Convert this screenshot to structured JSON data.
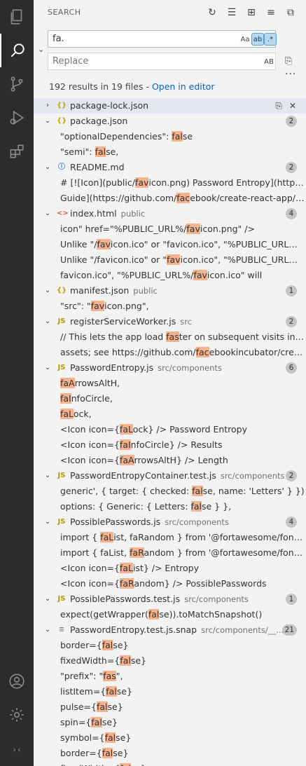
{
  "panel": {
    "title": "SEARCH",
    "search_value": "fa.",
    "match_case_label": "Aa",
    "whole_word_label": "ab",
    "regex_label": ".*",
    "replace_placeholder": "Replace",
    "preserve_case_label": "AB",
    "summary_text": "192 results in 19 files - ",
    "open_in_editor": "Open in editor",
    "more": "···"
  },
  "results": [
    {
      "type": "file",
      "chev": "›",
      "icon": "{}",
      "iconClass": "ic-json",
      "name": "package-lock.json",
      "path": "",
      "badge": "",
      "selected": true,
      "actions": true
    },
    {
      "type": "file",
      "chev": "⌄",
      "icon": "{}",
      "iconClass": "ic-json",
      "name": "package.json",
      "path": "",
      "badge": "2"
    },
    {
      "type": "match",
      "segments": [
        [
          "\"optionalDependencies\": ",
          false
        ],
        [
          "fal",
          true
        ],
        [
          "se",
          false
        ]
      ]
    },
    {
      "type": "match",
      "segments": [
        [
          "\"semi\": ",
          false
        ],
        [
          "fal",
          true
        ],
        [
          "se,",
          false
        ]
      ]
    },
    {
      "type": "file",
      "chev": "⌄",
      "icon": "ⓘ",
      "iconClass": "ic-md",
      "name": "README.md",
      "path": "",
      "badge": "2"
    },
    {
      "type": "match",
      "segments": [
        [
          "# [![Icon](public/",
          false
        ],
        [
          "fav",
          true
        ],
        [
          "icon.png) Password Entropy](https://",
          false
        ]
      ]
    },
    {
      "type": "match",
      "segments": [
        [
          "Guide](https://github.com/",
          false
        ],
        [
          "fac",
          true
        ],
        [
          "ebook/create-react-app/blob",
          false
        ]
      ]
    },
    {
      "type": "file",
      "chev": "⌄",
      "icon": "<>",
      "iconClass": "ic-html",
      "name": "index.html",
      "path": "public",
      "badge": "4"
    },
    {
      "type": "match",
      "segments": [
        [
          "icon\" href=\"%PUBLIC_URL%/",
          false
        ],
        [
          "fav",
          true
        ],
        [
          "icon.png\" />",
          false
        ]
      ]
    },
    {
      "type": "match",
      "segments": [
        [
          "Unlike \"/",
          false
        ],
        [
          "fav",
          true
        ],
        [
          "icon.ico\" or \"favicon.ico\", \"%PUBLIC_URL%/fav",
          false
        ]
      ]
    },
    {
      "type": "match",
      "segments": [
        [
          "Unlike \"/favicon.ico\" or \"",
          false
        ],
        [
          "fav",
          true
        ],
        [
          "icon.ico\", \"%PUBLIC_URL%/fav",
          false
        ]
      ]
    },
    {
      "type": "match",
      "segments": [
        [
          "favicon.ico\", \"%PUBLIC_URL%/",
          false
        ],
        [
          "fav",
          true
        ],
        [
          "icon.ico\" will",
          false
        ]
      ]
    },
    {
      "type": "file",
      "chev": "⌄",
      "icon": "{}",
      "iconClass": "ic-json",
      "name": "manifest.json",
      "path": "public",
      "badge": "1"
    },
    {
      "type": "match",
      "segments": [
        [
          "\"src\": \"",
          false
        ],
        [
          "fav",
          true
        ],
        [
          "icon.png\",",
          false
        ]
      ]
    },
    {
      "type": "file",
      "chev": "⌄",
      "icon": "JS",
      "iconClass": "ic-js",
      "name": "registerServiceWorker.js",
      "path": "src",
      "badge": "2"
    },
    {
      "type": "match",
      "segments": [
        [
          "// This lets the app load ",
          false
        ],
        [
          "fas",
          true
        ],
        [
          "ter on subsequent visits in pro",
          false
        ]
      ]
    },
    {
      "type": "match",
      "segments": [
        [
          "assets; see https://github.com/",
          false
        ],
        [
          "fac",
          true
        ],
        [
          "ebookincubator/create-",
          false
        ]
      ]
    },
    {
      "type": "file",
      "chev": "⌄",
      "icon": "JS",
      "iconClass": "ic-js",
      "name": "PasswordEntropy.js",
      "path": "src/components",
      "badge": "6"
    },
    {
      "type": "match",
      "segments": [
        [
          "faA",
          true
        ],
        [
          "rrowsAltH,",
          false
        ]
      ]
    },
    {
      "type": "match",
      "segments": [
        [
          "faI",
          true
        ],
        [
          "nfoCircle,",
          false
        ]
      ]
    },
    {
      "type": "match",
      "segments": [
        [
          "faL",
          true
        ],
        [
          "ock,",
          false
        ]
      ]
    },
    {
      "type": "match",
      "segments": [
        [
          "<Icon icon={",
          false
        ],
        [
          "faL",
          true
        ],
        [
          "ock} /> Password Entropy",
          false
        ]
      ]
    },
    {
      "type": "match",
      "segments": [
        [
          "<Icon icon={",
          false
        ],
        [
          "faI",
          true
        ],
        [
          "nfoCircle} /> Results",
          false
        ]
      ]
    },
    {
      "type": "match",
      "segments": [
        [
          "<Icon icon={",
          false
        ],
        [
          "faA",
          true
        ],
        [
          "rrowsAltH} /> Length",
          false
        ]
      ]
    },
    {
      "type": "file",
      "chev": "⌄",
      "icon": "JS",
      "iconClass": "ic-js",
      "name": "PasswordEntropyContainer.test.js",
      "path": "src/components",
      "badge": "2"
    },
    {
      "type": "match",
      "segments": [
        [
          "generic', { target: { checked: ",
          false
        ],
        [
          "fal",
          true
        ],
        [
          "se, name: 'Letters' } })",
          false
        ]
      ]
    },
    {
      "type": "match",
      "segments": [
        [
          "options: { Generic: { Letters: ",
          false
        ],
        [
          "fal",
          true
        ],
        [
          "se } },",
          false
        ]
      ]
    },
    {
      "type": "file",
      "chev": "⌄",
      "icon": "JS",
      "iconClass": "ic-js",
      "name": "PossiblePasswords.js",
      "path": "src/components",
      "badge": "4"
    },
    {
      "type": "match",
      "segments": [
        [
          "import { ",
          false
        ],
        [
          "faL",
          true
        ],
        [
          "ist, faRandom } from '@fortawesome/fontawe",
          false
        ]
      ]
    },
    {
      "type": "match",
      "segments": [
        [
          "import { faList, ",
          false
        ],
        [
          "faR",
          true
        ],
        [
          "andom } from '@fortawesome/fontawe",
          false
        ]
      ]
    },
    {
      "type": "match",
      "segments": [
        [
          "<Icon icon={",
          false
        ],
        [
          "faL",
          true
        ],
        [
          "ist} /> Entropy",
          false
        ]
      ]
    },
    {
      "type": "match",
      "segments": [
        [
          "<Icon icon={",
          false
        ],
        [
          "faR",
          true
        ],
        [
          "andom} /> PossiblePasswords",
          false
        ]
      ]
    },
    {
      "type": "file",
      "chev": "⌄",
      "icon": "JS",
      "iconClass": "ic-js",
      "name": "PossiblePasswords.test.js",
      "path": "src/components",
      "badge": "1"
    },
    {
      "type": "match",
      "segments": [
        [
          "expect(getWrapper(",
          false
        ],
        [
          "fal",
          true
        ],
        [
          "se)).toMatchSnapshot()",
          false
        ]
      ]
    },
    {
      "type": "file",
      "chev": "⌄",
      "icon": "≡",
      "iconClass": "ic-snap",
      "name": "PasswordEntropy.test.js.snap",
      "path": "src/components/__...",
      "badge": "21"
    },
    {
      "type": "match",
      "segments": [
        [
          "border={",
          false
        ],
        [
          "fal",
          true
        ],
        [
          "se}",
          false
        ]
      ]
    },
    {
      "type": "match",
      "segments": [
        [
          "fixedWidth={",
          false
        ],
        [
          "fal",
          true
        ],
        [
          "se}",
          false
        ]
      ]
    },
    {
      "type": "match",
      "segments": [
        [
          "\"prefix\": \"",
          false
        ],
        [
          "fas",
          true
        ],
        [
          "\",",
          false
        ]
      ]
    },
    {
      "type": "match",
      "segments": [
        [
          "listItem={",
          false
        ],
        [
          "fal",
          true
        ],
        [
          "se}",
          false
        ]
      ]
    },
    {
      "type": "match",
      "segments": [
        [
          "pulse={",
          false
        ],
        [
          "fal",
          true
        ],
        [
          "se}",
          false
        ]
      ]
    },
    {
      "type": "match",
      "segments": [
        [
          "spin={",
          false
        ],
        [
          "fal",
          true
        ],
        [
          "se}",
          false
        ]
      ]
    },
    {
      "type": "match",
      "segments": [
        [
          "symbol={",
          false
        ],
        [
          "fal",
          true
        ],
        [
          "se}",
          false
        ]
      ]
    },
    {
      "type": "match",
      "segments": [
        [
          "border={",
          false
        ],
        [
          "fal",
          true
        ],
        [
          "se}",
          false
        ]
      ]
    },
    {
      "type": "match",
      "segments": [
        [
          "fixedWidth={",
          false
        ],
        [
          "fal",
          true
        ],
        [
          "se}",
          false
        ]
      ]
    }
  ]
}
